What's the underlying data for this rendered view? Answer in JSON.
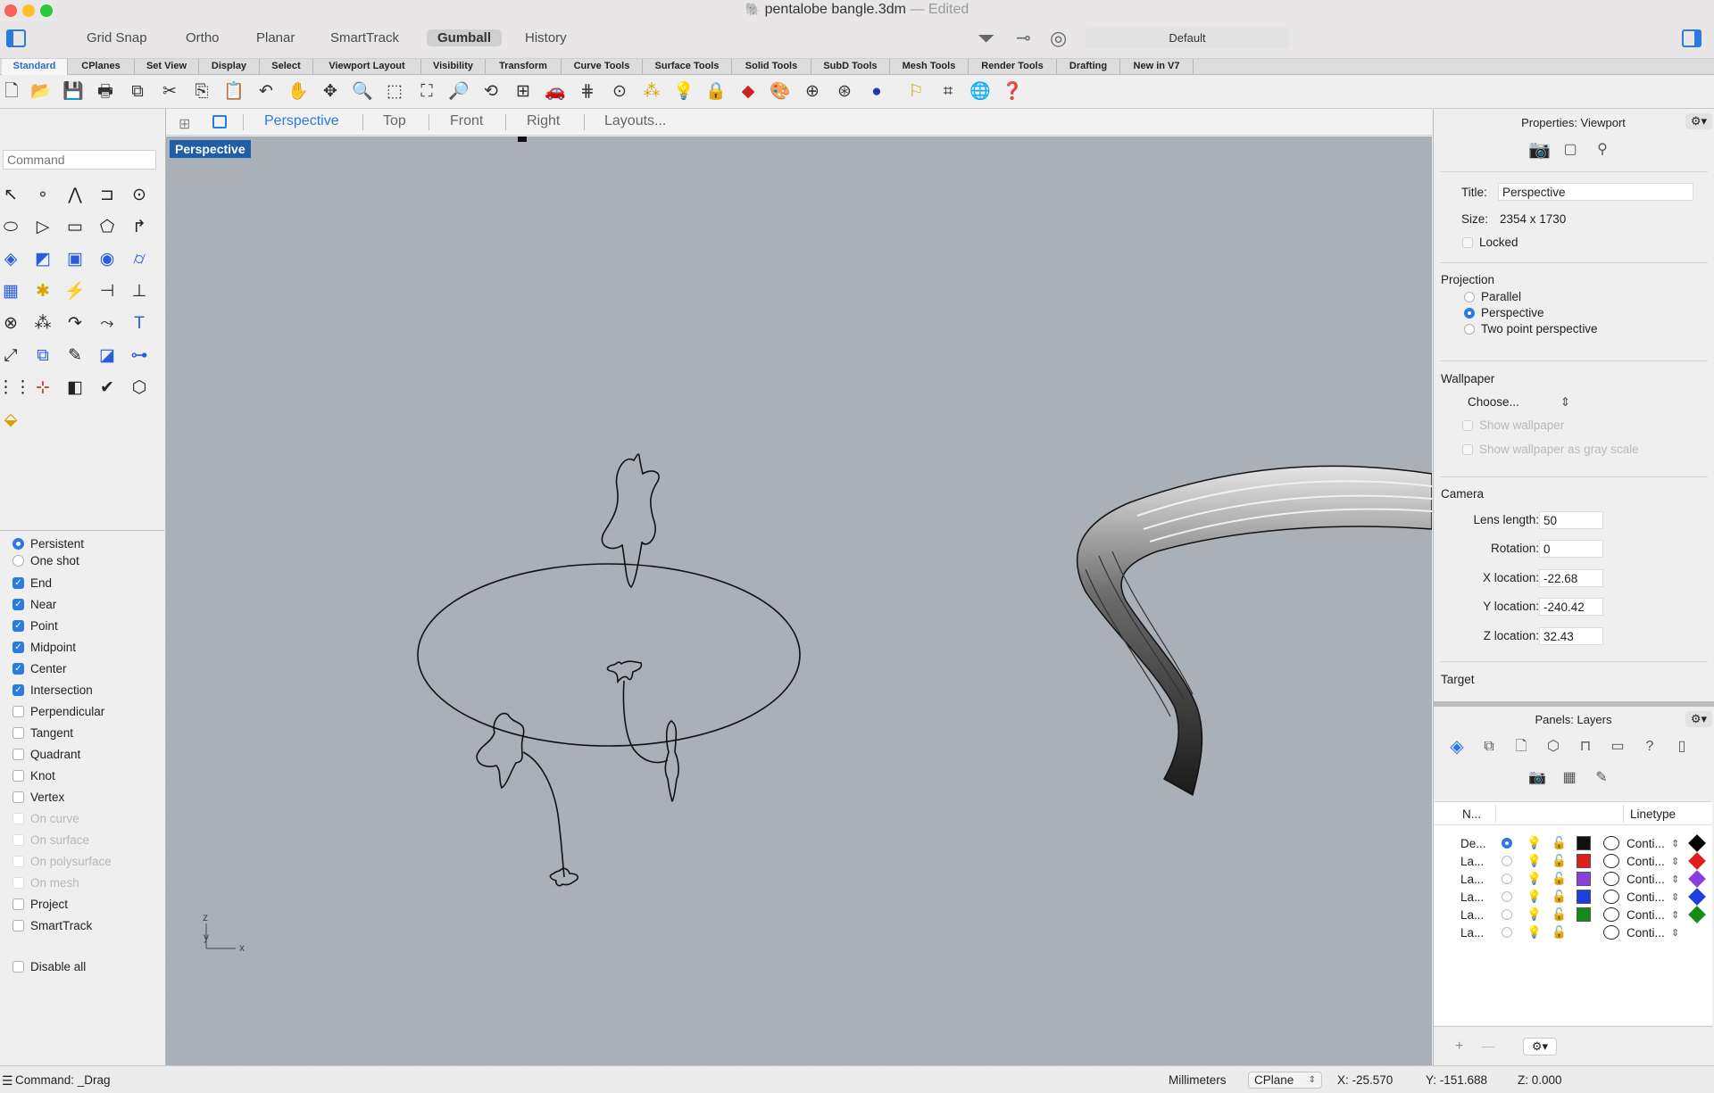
{
  "window": {
    "filename": "pentalobe bangle.3dm",
    "separator": "—",
    "status": "Edited",
    "toggles": [
      "Grid Snap",
      "Ortho",
      "Planar",
      "SmartTrack",
      "Gumball",
      "History"
    ],
    "active_toggle": "Gumball",
    "layer_default": "Default"
  },
  "toolbar_tabs": [
    "Standard",
    "CPlanes",
    "Set View",
    "Display",
    "Select",
    "Viewport Layout",
    "Visibility",
    "Transform",
    "Curve Tools",
    "Surface Tools",
    "Solid Tools",
    "SubD Tools",
    "Mesh Tools",
    "Render Tools",
    "Drafting",
    "New in V7"
  ],
  "command": {
    "placeholder": "Command"
  },
  "viewport": {
    "tabs": [
      "Perspective",
      "Top",
      "Front",
      "Right",
      "Layouts..."
    ],
    "active_tab": "Perspective",
    "label": "Perspective",
    "axis": {
      "z": "z",
      "y": "y",
      "x": "x"
    }
  },
  "osnap": {
    "mode": [
      {
        "label": "Persistent",
        "selected": true
      },
      {
        "label": "One shot",
        "selected": false
      }
    ],
    "items": [
      {
        "label": "End",
        "checked": true,
        "enabled": true
      },
      {
        "label": "Near",
        "checked": true,
        "enabled": true
      },
      {
        "label": "Point",
        "checked": true,
        "enabled": true
      },
      {
        "label": "Midpoint",
        "checked": true,
        "enabled": true
      },
      {
        "label": "Center",
        "checked": true,
        "enabled": true
      },
      {
        "label": "Intersection",
        "checked": true,
        "enabled": true
      },
      {
        "label": "Perpendicular",
        "checked": false,
        "enabled": true
      },
      {
        "label": "Tangent",
        "checked": false,
        "enabled": true
      },
      {
        "label": "Quadrant",
        "checked": false,
        "enabled": true
      },
      {
        "label": "Knot",
        "checked": false,
        "enabled": true
      },
      {
        "label": "Vertex",
        "checked": false,
        "enabled": true
      },
      {
        "label": "On curve",
        "checked": false,
        "enabled": false
      },
      {
        "label": "On surface",
        "checked": false,
        "enabled": false
      },
      {
        "label": "On polysurface",
        "checked": false,
        "enabled": false
      },
      {
        "label": "On mesh",
        "checked": false,
        "enabled": false
      },
      {
        "label": "Project",
        "checked": false,
        "enabled": true
      },
      {
        "label": "SmartTrack",
        "checked": false,
        "enabled": true
      }
    ],
    "disable_all": "Disable all"
  },
  "properties": {
    "header": "Properties: Viewport",
    "title_label": "Title:",
    "title_value": "Perspective",
    "size_label": "Size:",
    "size_value": "2354 x 1730",
    "locked_label": "Locked",
    "projection_header": "Projection",
    "projection_options": [
      {
        "label": "Parallel",
        "selected": false
      },
      {
        "label": "Perspective",
        "selected": true
      },
      {
        "label": "Two point perspective",
        "selected": false
      }
    ],
    "wallpaper_header": "Wallpaper",
    "wallpaper_choose": "Choose...",
    "show_wallpaper": "Show wallpaper",
    "show_wallpaper_gray": "Show wallpaper as gray scale",
    "camera_header": "Camera",
    "camera_fields": [
      {
        "label": "Lens length:",
        "value": "50"
      },
      {
        "label": "Rotation:",
        "value": "0"
      },
      {
        "label": "X location:",
        "value": "-22.68"
      },
      {
        "label": "Y location:",
        "value": "-240.42"
      },
      {
        "label": "Z location:",
        "value": "32.43"
      }
    ],
    "target_header": "Target"
  },
  "layers": {
    "header": "Panels: Layers",
    "col_name": "N...",
    "col_linetype": "Linetype",
    "rows": [
      {
        "name": "De...",
        "current": true,
        "color": "#111111",
        "linetype": "Conti...",
        "mat": "#000000"
      },
      {
        "name": "La...",
        "current": false,
        "color": "#dd1f1f",
        "linetype": "Conti...",
        "mat": "#dd1f1f"
      },
      {
        "name": "La...",
        "current": false,
        "color": "#8a3fdc",
        "linetype": "Conti...",
        "mat": "#8a3fdc"
      },
      {
        "name": "La...",
        "current": false,
        "color": "#1c3fe0",
        "linetype": "Conti...",
        "mat": "#1c3fe0"
      },
      {
        "name": "La...",
        "current": false,
        "color": "#178a17",
        "linetype": "Conti...",
        "mat": "#178a17"
      },
      {
        "name": "La...",
        "current": false,
        "color": "#ffffff",
        "linetype": "Conti...",
        "mat": "#ffffff"
      }
    ],
    "add": "+",
    "remove": "—"
  },
  "statusbar": {
    "command": "Command: _Drag",
    "units": "Millimeters",
    "cplane": "CPlane",
    "x": "X: -25.570",
    "y": "Y: -151.688",
    "z": "Z: 0.000"
  }
}
